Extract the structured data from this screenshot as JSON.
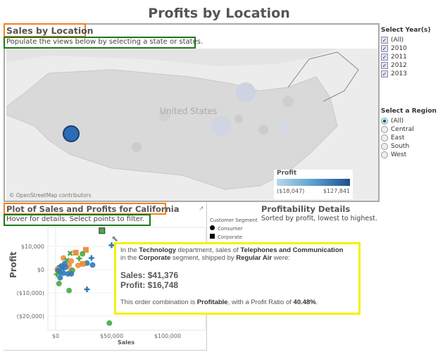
{
  "dashboard": {
    "title": "Profits by Location"
  },
  "map_view": {
    "title": "Sales by Location",
    "subtitle": "Populate the views below by selecting a state or states.",
    "country_label": "United States",
    "attribution": "© OpenStreetMap contributors",
    "legend": {
      "title": "Profit",
      "min_label": "($18,047)",
      "max_label": "$127,841",
      "color_low": "#b8d8ea",
      "color_high": "#1f4e8c"
    },
    "marker_color": "#2a6db5"
  },
  "year_filter": {
    "title": "Select Year(s)",
    "items": [
      {
        "label": "(All)",
        "checked": true
      },
      {
        "label": "2010",
        "checked": true
      },
      {
        "label": "2011",
        "checked": true
      },
      {
        "label": "2012",
        "checked": true
      },
      {
        "label": "2013",
        "checked": true
      }
    ]
  },
  "region_filter": {
    "title": "Select a Region",
    "items": [
      {
        "label": "(All)",
        "selected": true
      },
      {
        "label": "Central",
        "selected": false
      },
      {
        "label": "East",
        "selected": false
      },
      {
        "label": "South",
        "selected": false
      },
      {
        "label": "West",
        "selected": false
      }
    ]
  },
  "scatter_view": {
    "title": "Plot of Sales and Profits for California",
    "subtitle": "Hover for details. Select points to filter."
  },
  "legend_segment": {
    "title": "Customer Segment",
    "items": [
      {
        "label": "Consumer",
        "shape": "circle"
      },
      {
        "label": "Corporate",
        "shape": "square"
      }
    ]
  },
  "details": {
    "title": "Profitability Details",
    "subtitle": "Sorted by profit, lowest to highest."
  },
  "tooltip": {
    "l1a": "In the ",
    "department": "Technology",
    "l1b": " department, sales of ",
    "product": "Telephones and Communication",
    "l2a": "in the ",
    "segment": "Corporate",
    "l2b": " segment, shipped by ",
    "ship_mode": "Regular Air",
    "l2c": " were:",
    "sales": "Sales: $41,376",
    "profit": "Profit: $16,748",
    "l3a": "This order combination is ",
    "status": "Profitable",
    "l3b": ", with a Profit Ratio of ",
    "ratio": "40.48%",
    "l3c": "."
  },
  "chart_data": {
    "type": "scatter",
    "xlabel": "Sales",
    "ylabel": "Profit",
    "xlim": [
      -7000,
      130000
    ],
    "ylim": [
      -27000,
      18000
    ],
    "x_ticks": [
      "$0",
      "$50,000",
      "$100,000"
    ],
    "x_tick_values": [
      0,
      50000,
      100000
    ],
    "y_ticks": [
      "$10,000",
      "$0",
      "($10,000)",
      "($20,000)"
    ],
    "y_tick_values": [
      10000,
      0,
      -10000,
      -20000
    ],
    "colors": {
      "blue": "#2f7ab8",
      "orange": "#f28e3c",
      "green": "#4aa84a"
    },
    "points": [
      {
        "x": 41376,
        "y": 16748,
        "color": "green",
        "shape": "square"
      },
      {
        "x": 50000,
        "y": 10500,
        "color": "blue",
        "shape": "plus"
      },
      {
        "x": 27000,
        "y": 8500,
        "color": "orange",
        "shape": "square"
      },
      {
        "x": 18000,
        "y": 7300,
        "color": "orange",
        "shape": "square"
      },
      {
        "x": 24000,
        "y": 6800,
        "color": "green",
        "shape": "circle"
      },
      {
        "x": 13000,
        "y": 7000,
        "color": "green",
        "shape": "x"
      },
      {
        "x": 32000,
        "y": 5000,
        "color": "blue",
        "shape": "plus"
      },
      {
        "x": 21000,
        "y": 4800,
        "color": "green",
        "shape": "plus"
      },
      {
        "x": 7000,
        "y": 5000,
        "color": "orange",
        "shape": "circle"
      },
      {
        "x": 10000,
        "y": 4000,
        "color": "green",
        "shape": "x"
      },
      {
        "x": 14000,
        "y": 3700,
        "color": "orange",
        "shape": "circle"
      },
      {
        "x": 28000,
        "y": 2800,
        "color": "blue",
        "shape": "circle"
      },
      {
        "x": 24000,
        "y": 2500,
        "color": "orange",
        "shape": "square"
      },
      {
        "x": 33000,
        "y": 2000,
        "color": "blue",
        "shape": "circle"
      },
      {
        "x": 20000,
        "y": 1800,
        "color": "orange",
        "shape": "circle"
      },
      {
        "x": 12000,
        "y": 2000,
        "color": "orange",
        "shape": "circle"
      },
      {
        "x": 8000,
        "y": 2500,
        "color": "blue",
        "shape": "circle"
      },
      {
        "x": 5000,
        "y": 1500,
        "color": "blue",
        "shape": "circle"
      },
      {
        "x": 3000,
        "y": 800,
        "color": "blue",
        "shape": "circle"
      },
      {
        "x": 1500,
        "y": 200,
        "color": "orange",
        "shape": "circle"
      },
      {
        "x": 2000,
        "y": -500,
        "color": "blue",
        "shape": "circle"
      },
      {
        "x": 6000,
        "y": 500,
        "color": "blue",
        "shape": "x"
      },
      {
        "x": 9000,
        "y": 1000,
        "color": "blue",
        "shape": "circle"
      },
      {
        "x": 13000,
        "y": 0,
        "color": "orange",
        "shape": "x"
      },
      {
        "x": 15000,
        "y": -300,
        "color": "green",
        "shape": "circle"
      },
      {
        "x": 4000,
        "y": -1200,
        "color": "blue",
        "shape": "circle"
      },
      {
        "x": 11000,
        "y": -1800,
        "color": "blue",
        "shape": "circle"
      },
      {
        "x": 14000,
        "y": -1800,
        "color": "blue",
        "shape": "circle"
      },
      {
        "x": 7000,
        "y": -1500,
        "color": "blue",
        "shape": "circle"
      },
      {
        "x": 1000,
        "y": -2000,
        "color": "green",
        "shape": "plus"
      },
      {
        "x": 4000,
        "y": -3500,
        "color": "blue",
        "shape": "circle"
      },
      {
        "x": 3000,
        "y": -6000,
        "color": "green",
        "shape": "circle"
      },
      {
        "x": 12000,
        "y": -9000,
        "color": "green",
        "shape": "circle"
      },
      {
        "x": 28000,
        "y": -8500,
        "color": "blue",
        "shape": "plus"
      },
      {
        "x": 48000,
        "y": -23000,
        "color": "green",
        "shape": "circle"
      }
    ]
  }
}
